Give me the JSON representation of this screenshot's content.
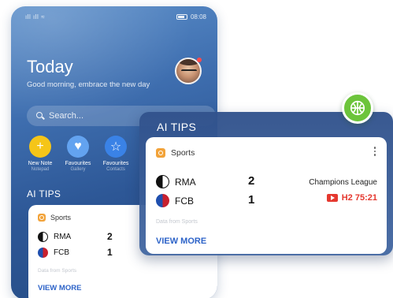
{
  "status_bar": {
    "signal": "⁹™⁹™ ≈",
    "time": "08:08"
  },
  "home": {
    "title": "Today",
    "subtitle": "Good morning, embrace the new day",
    "search_placeholder": "Search..."
  },
  "apps": [
    {
      "label": "New Note",
      "sub": "Notepad",
      "color": "#f5c518",
      "glyph": "+",
      "icon": "plus-icon"
    },
    {
      "label": "Favourites",
      "sub": "Gallery",
      "color": "#63a3f0",
      "glyph": "♥",
      "icon": "heart-icon"
    },
    {
      "label": "Favourites",
      "sub": "Contacts",
      "color": "#3a82e6",
      "glyph": "☆",
      "icon": "star-icon"
    }
  ],
  "phone_widget": {
    "section_title": "AI TIPS",
    "card_label": "Sports",
    "team1": {
      "name": "RMA",
      "score": "2"
    },
    "team2": {
      "name": "FCB",
      "score": "1"
    },
    "source": "Data from Sports",
    "more": "VIEW MORE"
  },
  "floating_widget": {
    "section_title": "AI TIPS",
    "card_label": "Sports",
    "team1": {
      "name": "RMA",
      "score": "2"
    },
    "team2": {
      "name": "FCB",
      "score": "1"
    },
    "league": "Champions League",
    "match_status": "H2 75:21",
    "source": "Data from Sports",
    "more": "VIEW MORE"
  },
  "colors": {
    "accent_blue": "#2d63c8",
    "live_red": "#e5382f",
    "badge_green": "#6cc43b",
    "sport_orange": "#f2a33a"
  }
}
